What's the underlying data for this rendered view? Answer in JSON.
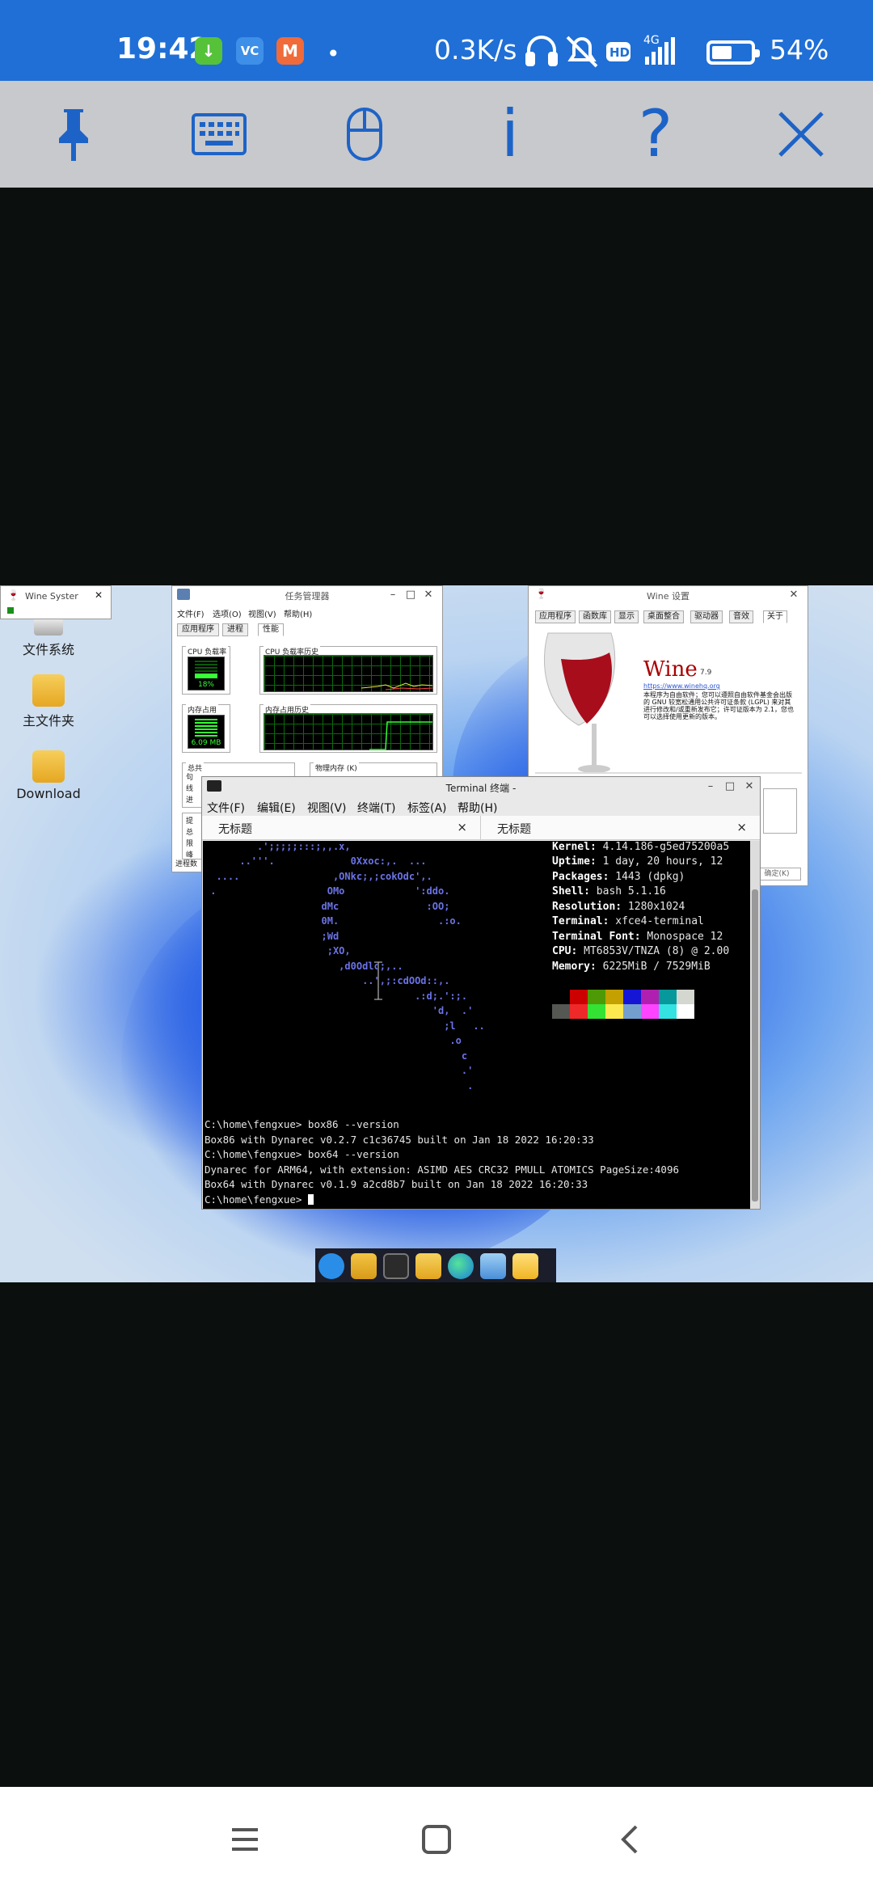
{
  "status_bar": {
    "time": "19:42",
    "app_badges": [
      {
        "glyph": "↓",
        "color": "#55c23a"
      },
      {
        "glyph": "VC",
        "color": "#3d8fe8"
      },
      {
        "glyph": "M",
        "color": "#f06a3a"
      }
    ],
    "dot": "•",
    "net_speed": "0.3K/s",
    "hd": "HD",
    "network": "4G",
    "battery_percent": 54,
    "battery_label": "54%"
  },
  "toolbar": {
    "buttons": [
      "pin",
      "keyboard",
      "mouse",
      "info",
      "help",
      "close"
    ],
    "info_glyph": "i",
    "help_glyph": "?"
  },
  "desktop": {
    "icons": [
      {
        "label": "文件系统"
      },
      {
        "label": "主文件夹"
      },
      {
        "label": "Download"
      }
    ],
    "wine_system_window": {
      "title": "Wine Syster",
      "close": "✕"
    }
  },
  "task_manager": {
    "title": "任务管理器",
    "menu": [
      "文件(F)",
      "选项(O)",
      "视图(V)",
      "帮助(H)"
    ],
    "tabs": [
      "应用程序",
      "进程",
      "性能"
    ],
    "groups": {
      "cpu_usage": "CPU 负载率",
      "cpu_history": "CPU 负载率历史",
      "mem_usage": "内存占用",
      "mem_history": "内存占用历史",
      "total": "总共",
      "physical_mem": "物理内存 (K)"
    },
    "cpu_value": "18%",
    "mem_value": "6.09 MB",
    "side_labels": [
      "句",
      "线",
      "进"
    ],
    "side_labels_2": [
      "提",
      "总",
      "限",
      "峰"
    ],
    "footer": "进程数"
  },
  "wine_settings": {
    "title": "Wine 设置",
    "tabs": [
      "应用程序",
      "函数库",
      "显示",
      "桌面整合",
      "驱动器",
      "音效",
      "关于"
    ],
    "brand": "Wine",
    "version": "7.9",
    "url": "https://www.winehq.org",
    "description": "本程序为自由软件；您可以遵照自由软件基金会出版的 GNU 较宽松通用公共许可证条款 (LGPL) 来对其进行修改和/或重新发布它；许可证版本为 2.1，您也可以选择使用更新的版本。",
    "button": "确定(K)"
  },
  "terminal": {
    "title": "Terminal 终端 -",
    "menu": [
      "文件(F)",
      "编辑(E)",
      "视图(V)",
      "终端(T)",
      "标签(A)",
      "帮助(H)"
    ],
    "tabs": [
      "无标题",
      "无标题"
    ],
    "tab_close": "×",
    "logo_lines": [
      "         .';;;;;:::;,,.x,",
      "      ..'''.             0Xxoc:,.  ...",
      "  ....                ,ONkc;,;cokOdc',.",
      " .                   OMo            ':ddo.",
      "                    dMc               :OO;",
      "                    0M.                 .:o.",
      "                    ;Wd",
      "                     ;XO,",
      "                       ,d0Odlc;,..",
      "                           ..',;:cdOOd::,.",
      "                                    .:d;.':;.",
      "                                       'd,  .'",
      "                                         ;l   ..",
      "                                          .o",
      "                                            c",
      "                                            .'",
      "                                             ."
    ],
    "info": [
      {
        "k": "Kernel:",
        "v": " 4.14.186-g5ed75200a5"
      },
      {
        "k": "Uptime:",
        "v": " 1 day, 20 hours, 12"
      },
      {
        "k": "Packages:",
        "v": " 1443 (dpkg)"
      },
      {
        "k": "Shell:",
        "v": " bash 5.1.16"
      },
      {
        "k": "Resolution:",
        "v": " 1280x1024"
      },
      {
        "k": "Terminal:",
        "v": " xfce4-terminal"
      },
      {
        "k": "Terminal Font:",
        "v": " Monospace 12"
      },
      {
        "k": "CPU:",
        "v": " MT6853V/TNZA (8) @ 2.00"
      },
      {
        "k": "Memory:",
        "v": " 6225MiB / 7529MiB"
      }
    ],
    "swatches_top": [
      "#000000",
      "#cc0000",
      "#4e9a06",
      "#c4a000",
      "#1515d6",
      "#b020b0",
      "#06989a",
      "#d3d7cf"
    ],
    "swatches_bottom": [
      "#555753",
      "#ef2929",
      "#34e234",
      "#fce94f",
      "#739fcf",
      "#ff44ff",
      "#34e2e2",
      "#ffffff"
    ],
    "command_lines": [
      "C:\\home\\fengxue> box86 --version",
      "Box86 with Dynarec v0.2.7 c1c36745 built on Jan 18 2022 16:20:33",
      "C:\\home\\fengxue> box64 --version",
      "Dynarec for ARM64, with extension: ASIMD AES CRC32 PMULL ATOMICS PageSize:4096",
      "Box64 with Dynarec v0.1.9 a2cd8b7 built on Jan 18 2022 16:20:33"
    ],
    "prompt": "C:\\home\\fengxue> "
  },
  "taskbar": {
    "icons": [
      "start-icon",
      "file-manager-icon",
      "terminal-icon",
      "folder-icon",
      "edge-browser-icon",
      "wine-icon",
      "notes-icon"
    ]
  },
  "colors": {
    "status_bar": "#1f6fd6",
    "toolbar_bg": "#c8c9cc",
    "toolbar_icons": "#1d63c7",
    "terminal_logo": "#6b73e6"
  }
}
